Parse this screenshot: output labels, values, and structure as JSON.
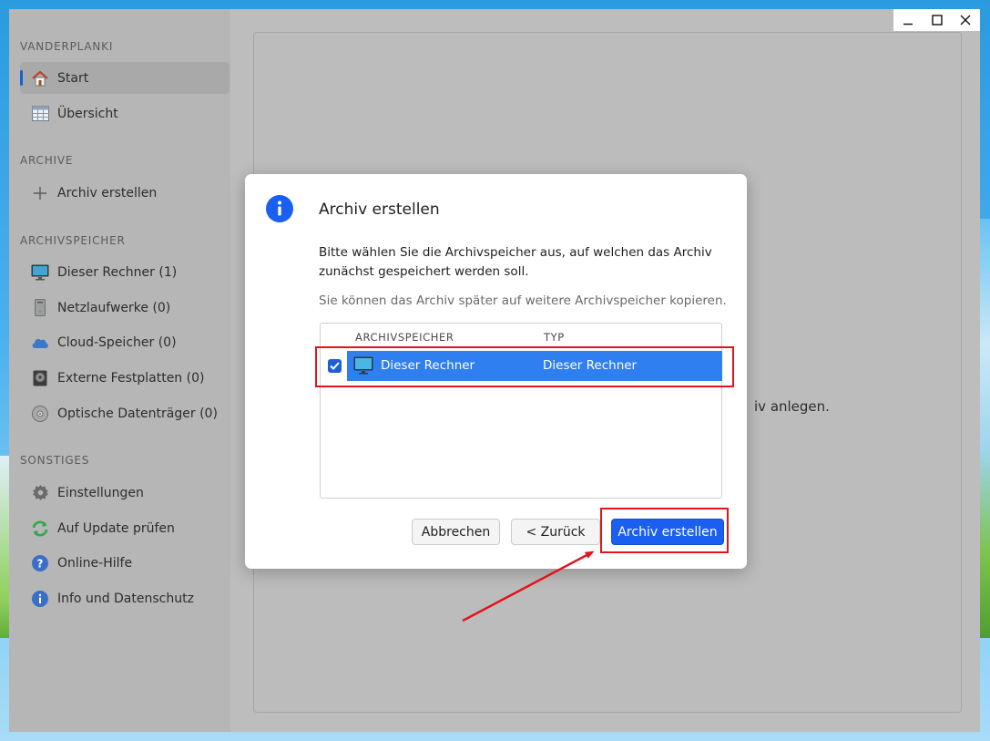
{
  "app": {
    "sidebar": {
      "sections": [
        {
          "title": "VANDERPLANKI",
          "items": [
            {
              "label": "Start",
              "icon": "home-icon",
              "active": true
            },
            {
              "label": "Übersicht",
              "icon": "table-icon"
            }
          ]
        },
        {
          "title": "ARCHIVE",
          "items": [
            {
              "label": "Archiv erstellen",
              "icon": "plus-icon"
            }
          ]
        },
        {
          "title": "ARCHIVSPEICHER",
          "items": [
            {
              "label": "Dieser Rechner (1)",
              "icon": "monitor-icon"
            },
            {
              "label": "Netzlaufwerke (0)",
              "icon": "server-icon"
            },
            {
              "label": "Cloud-Speicher (0)",
              "icon": "cloud-icon"
            },
            {
              "label": "Externe Festplatten (0)",
              "icon": "hard-drive-icon"
            },
            {
              "label": "Optische Datenträger (0)",
              "icon": "disc-icon"
            }
          ]
        },
        {
          "title": "SONSTIGES",
          "items": [
            {
              "label": "Einstellungen",
              "icon": "gear-icon"
            },
            {
              "label": "Auf Update prüfen",
              "icon": "refresh-icon"
            },
            {
              "label": "Online-Hilfe",
              "icon": "help-icon"
            },
            {
              "label": "Info und Datenschutz",
              "icon": "info-icon"
            }
          ]
        }
      ]
    },
    "background_text": "iv anlegen.",
    "window_controls": {
      "minimize": "minimize-icon",
      "maximize": "maximize-icon",
      "close": "close-icon"
    }
  },
  "dialog": {
    "title": "Archiv erstellen",
    "message": "Bitte wählen Sie die Archivspeicher aus, auf welchen das Archiv zunächst gespeichert werden soll.",
    "hint": "Sie können das Archiv später auf weitere Archivspeicher kopieren.",
    "table": {
      "columns": [
        "ARCHIVSPEICHER",
        "TYP"
      ],
      "rows": [
        {
          "checked": true,
          "name": "Dieser Rechner",
          "type": "Dieser Rechner"
        }
      ]
    },
    "buttons": {
      "cancel": "Abbrechen",
      "back": "< Zurück",
      "create": "Archiv erstellen"
    }
  },
  "colors": {
    "accent": "#1a5ff0",
    "selection": "#2f7ff0",
    "annotation": "#e3141b"
  }
}
